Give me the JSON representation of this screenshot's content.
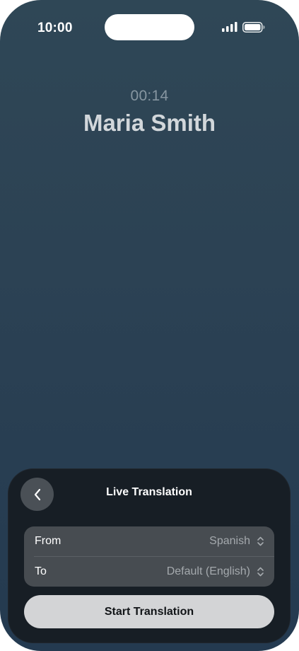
{
  "status_bar": {
    "time": "10:00",
    "signal_icon": "cellular-signal-icon",
    "battery_icon": "battery-icon"
  },
  "call": {
    "timer": "00:14",
    "caller_name": "Maria Smith"
  },
  "translation_sheet": {
    "title": "Live Translation",
    "back_icon": "chevron-left-icon",
    "rows": [
      {
        "label": "From",
        "value": "Spanish",
        "icon": "chevron-updown-icon"
      },
      {
        "label": "To",
        "value": "Default (English)",
        "icon": "chevron-updown-icon"
      }
    ],
    "start_button_label": "Start Translation"
  },
  "colors": {
    "background_top": "#2f4756",
    "background_bottom": "#243a50",
    "sheet_background": "#171e25",
    "panel_background": "#474c51",
    "button_background": "#d3d4d6"
  }
}
